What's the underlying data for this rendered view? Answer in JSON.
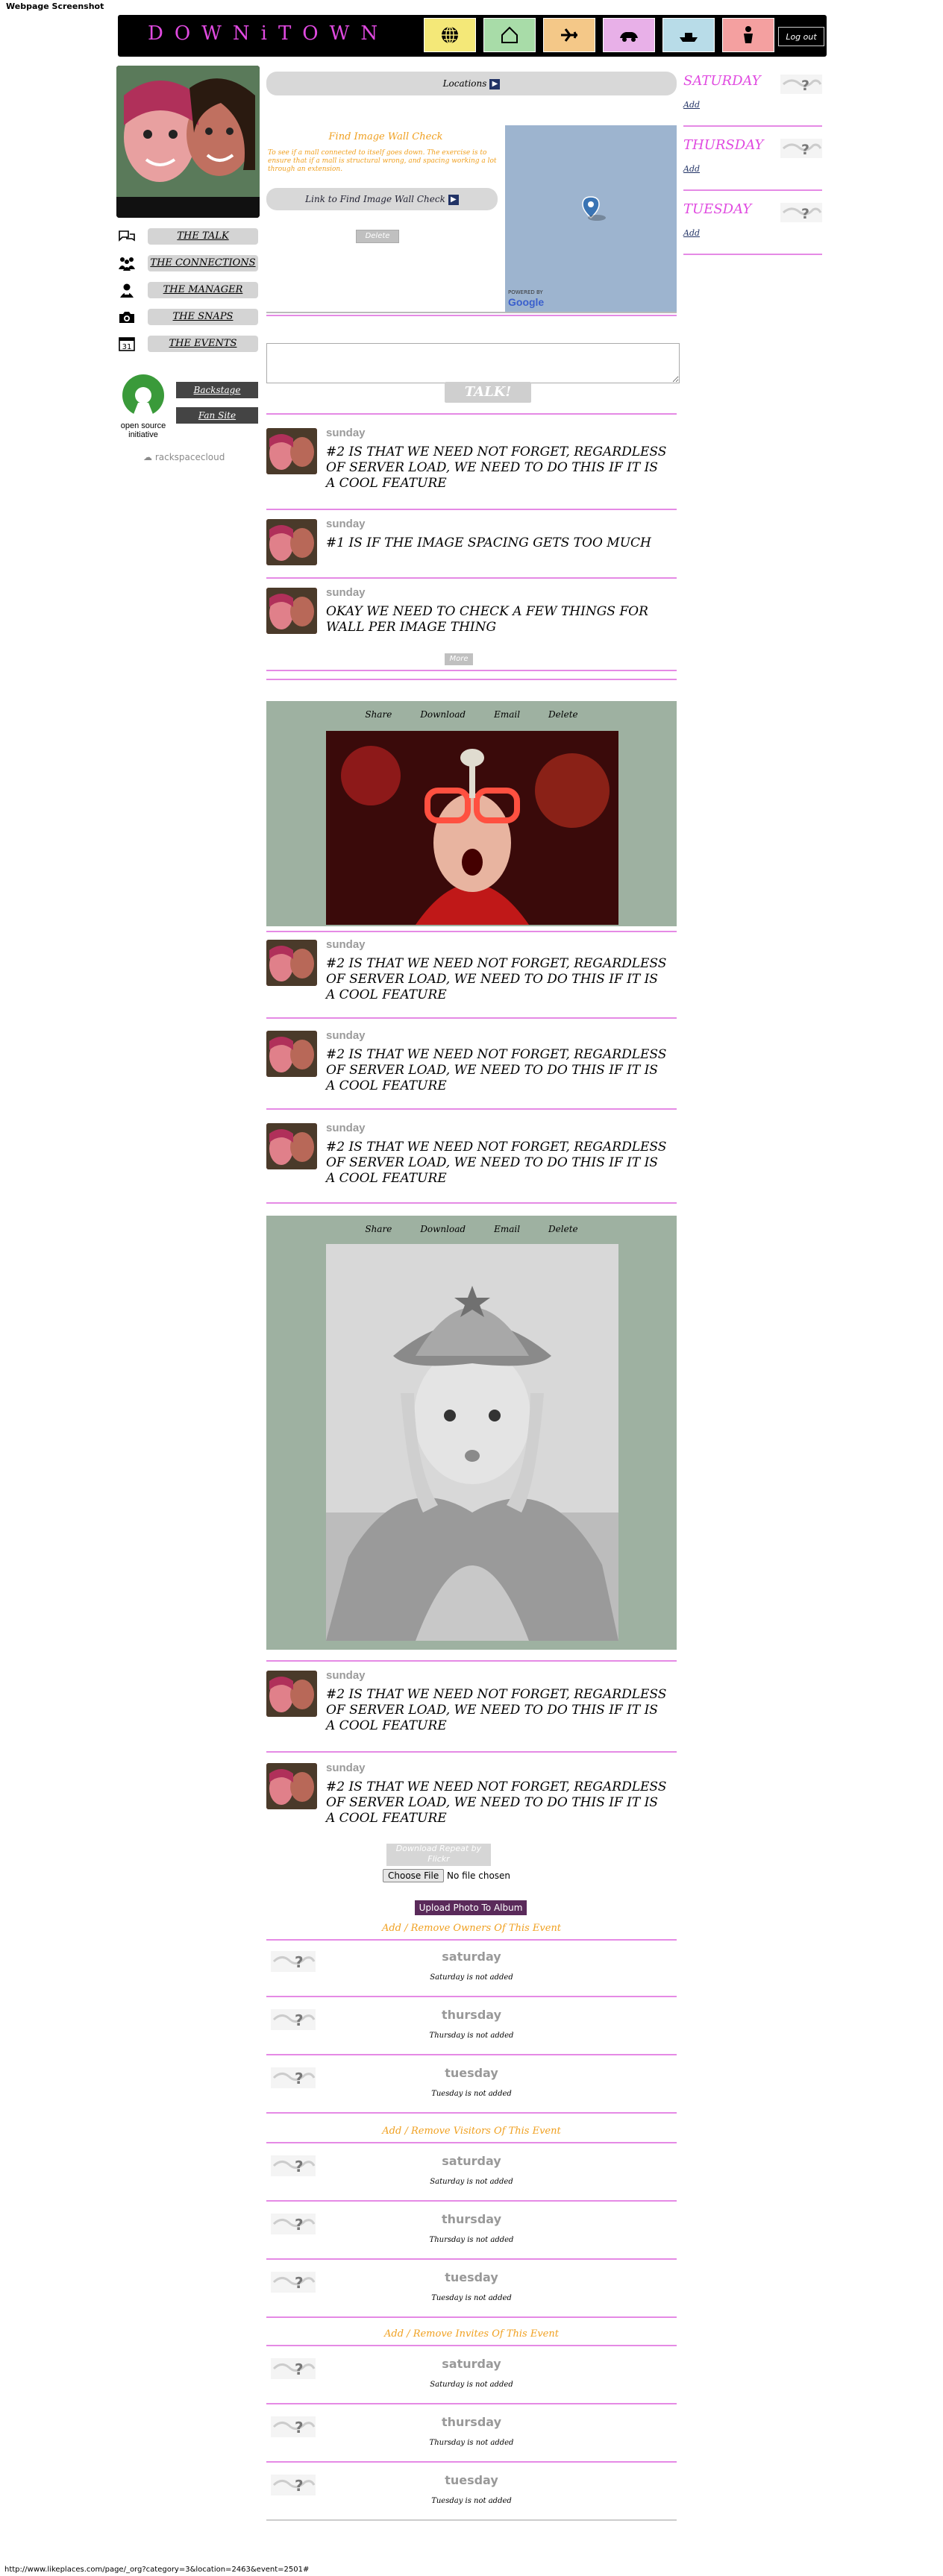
{
  "page_caption": "Webpage Screenshot",
  "status_url": "http://www.likeplaces.com/page/_org?category=3&location=2463&event=2501#",
  "header": {
    "logo_text": "DOWNiTOWN",
    "nav": [
      {
        "icon": "globe-icon",
        "color": "#f4e878"
      },
      {
        "icon": "home-icon",
        "color": "#a8dca8"
      },
      {
        "icon": "airplane-icon",
        "color": "#f4c888"
      },
      {
        "icon": "car-icon",
        "color": "#e8b0e8"
      },
      {
        "icon": "boat-icon",
        "color": "#b8dce8"
      },
      {
        "icon": "person-icon",
        "color": "#f4a0a0"
      }
    ],
    "logout_label": "Log out"
  },
  "left_menu": [
    {
      "icon": "talk-icon",
      "label": "THE TALK"
    },
    {
      "icon": "connections-icon",
      "label": "THE CONNECTIONS"
    },
    {
      "icon": "manager-icon",
      "label": "THE MANAGER"
    },
    {
      "icon": "camera-icon",
      "label": "THE SNAPS"
    },
    {
      "icon": "calendar-icon",
      "label": "THE EVENTS"
    }
  ],
  "calendar_icon_number": "31",
  "osi": {
    "line1": "open source",
    "line2": "initiative"
  },
  "dark_buttons": [
    "Backstage",
    "Fan Site"
  ],
  "rackspace_label": "rackspacecloud",
  "center": {
    "location_button": "Locations",
    "find_box": {
      "title": "Find Image Wall Check",
      "text": "To see if a mall connected to itself goes down. The exercise is to ensure that if a mall is structural wrong, and spacing working a lot through an extension.",
      "link": "Link to Find Image Wall Check",
      "delete_label": "Delete"
    },
    "map_powered_label": "POWERED BY",
    "map_brand": "Google",
    "talk_button": "TALK!",
    "more_label": "More",
    "photo_actions": [
      "Share",
      "Download",
      "Email",
      "Delete"
    ],
    "photo_posted_label": "Download Repeat by Flickr",
    "file_button": "Choose File",
    "file_status": "No file chosen",
    "upload_button": "Upload Photo To Album"
  },
  "posts_top": [
    {
      "day": "sunday",
      "text": "#2 is that we need not forget, regardless of server load, we need to do this if it is a cool feature"
    },
    {
      "day": "sunday",
      "text": "#1 is if the image spacing gets too much"
    },
    {
      "day": "sunday",
      "text": "okay we need to check a few things for wall per image thing"
    }
  ],
  "posts_middle": [
    {
      "day": "sunday",
      "text": "#2 is that we need not forget, regardless of server load, we need to do this if it is a cool feature"
    },
    {
      "day": "sunday",
      "text": "#2 is that we need not forget, regardless of server load, we need to do this if it is a cool feature"
    },
    {
      "day": "sunday",
      "text": "#2 is that we need not forget, regardless of server load, we need to do this if it is a cool feature"
    }
  ],
  "posts_bottom": [
    {
      "day": "sunday",
      "text": "#2 is that we need not forget, regardless of server load, we need to do this if it is a cool feature"
    },
    {
      "day": "sunday",
      "text": "#2 is that we need not forget, regardless of server load, we need to do this if it is a cool feature"
    }
  ],
  "sections": [
    {
      "title": "Add / Remove Owners Of This Event",
      "rows": [
        {
          "day": "saturday",
          "status": "Saturday is not added"
        },
        {
          "day": "thursday",
          "status": "Thursday is not added"
        },
        {
          "day": "tuesday",
          "status": "Tuesday is not added"
        }
      ]
    },
    {
      "title": "Add / Remove Visitors Of This Event",
      "rows": [
        {
          "day": "saturday",
          "status": "Saturday is not added"
        },
        {
          "day": "thursday",
          "status": "Thursday is not added"
        },
        {
          "day": "tuesday",
          "status": "Tuesday is not added"
        }
      ]
    },
    {
      "title": "Add / Remove Invites Of This Event",
      "rows": [
        {
          "day": "saturday",
          "status": "Saturday is not added"
        },
        {
          "day": "thursday",
          "status": "Thursday is not added"
        },
        {
          "day": "tuesday",
          "status": "Tuesday is not added"
        }
      ]
    }
  ],
  "right_column": [
    {
      "day": "SATURDAY",
      "link": "Add"
    },
    {
      "day": "THURSDAY",
      "link": "Add"
    },
    {
      "day": "TUESDAY",
      "link": "Add"
    }
  ],
  "colors": {
    "accent_pink": "#e58ae5",
    "accent_orange": "#f0a020",
    "photo_bg": "#9eb1a1"
  }
}
